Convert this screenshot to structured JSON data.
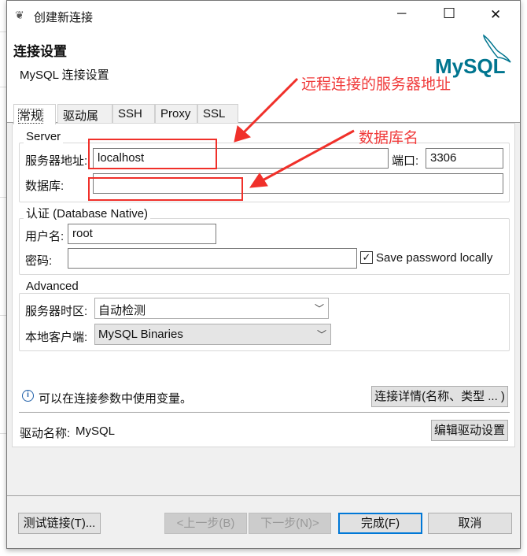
{
  "window": {
    "title": "创建新连接",
    "minimize": "─",
    "maximize": "☐",
    "close": "✕"
  },
  "header": {
    "title": "连接设置",
    "subtitle": "MySQL 连接设置",
    "logo_text": "MySQL",
    "logo_colors": {
      "my": "#00758f",
      "sql": "#f29111"
    }
  },
  "tabs": [
    {
      "label": "常规",
      "active": true
    },
    {
      "label": "驱动属性"
    },
    {
      "label": "SSH"
    },
    {
      "label": "Proxy"
    },
    {
      "label": "SSL"
    }
  ],
  "server": {
    "group_label": "Server",
    "host_label": "服务器地址:",
    "host_value": "localhost",
    "port_label": "端口:",
    "port_value": "3306",
    "db_label": "数据库:",
    "db_value": ""
  },
  "auth": {
    "group_label": "认证 (Database Native)",
    "user_label": "用户名:",
    "user_value": "root",
    "password_label": "密码:",
    "password_value": "",
    "save_password_label": "Save password locally",
    "save_password_checked": true
  },
  "advanced": {
    "group_label": "Advanced",
    "timezone_label": "服务器时区:",
    "timezone_value": "自动检测",
    "client_label": "本地客户端:",
    "client_value": "MySQL Binaries"
  },
  "info": {
    "text": "可以在连接参数中使用变量。",
    "details_button": "连接详情(名称、类型 ... )"
  },
  "driver": {
    "label": "驱动名称:",
    "value": "MySQL",
    "edit_button": "编辑驱动设置"
  },
  "footer": {
    "test": "测试链接(T)...",
    "back": "<上一步(B)",
    "next": "下一步(N)>",
    "finish": "完成(F)",
    "cancel": "取消"
  },
  "annotations": {
    "host_note": "远程连接的服务器地址",
    "db_note": "数据库名",
    "color": "#f0302a"
  }
}
